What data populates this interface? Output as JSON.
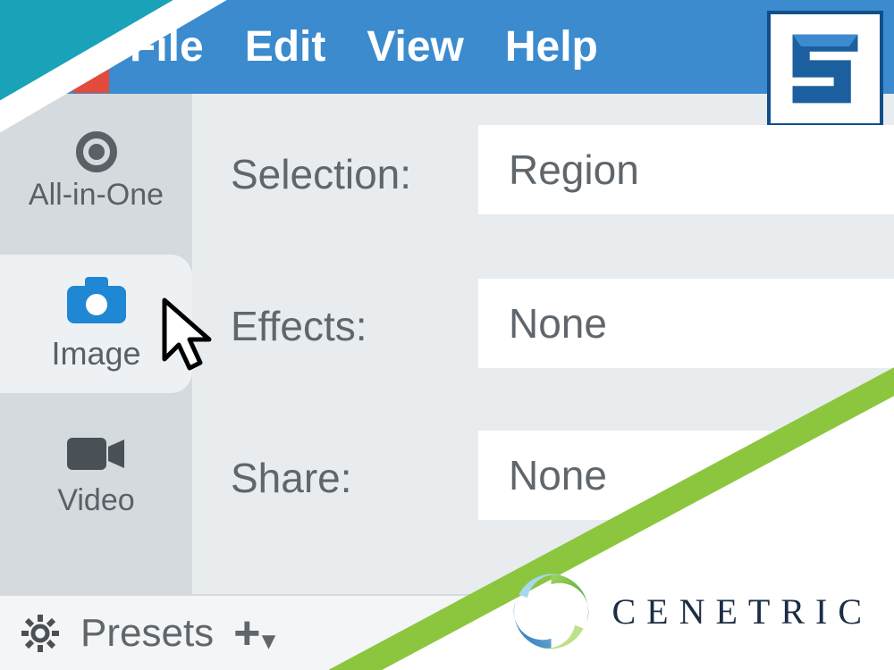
{
  "menu": {
    "file": "File",
    "edit": "Edit",
    "view": "View",
    "help": "Help"
  },
  "tabs": {
    "all": {
      "label": "All-in-One"
    },
    "image": {
      "label": "Image"
    },
    "video": {
      "label": "Video"
    }
  },
  "props": {
    "selection": {
      "label": "Selection:",
      "value": "Region"
    },
    "effects": {
      "label": "Effects:",
      "value": "None"
    },
    "share": {
      "label": "Share:",
      "value": "None"
    }
  },
  "bottom": {
    "presets": "Presets",
    "add": "+"
  },
  "branding": {
    "cenetric": "CENETRIC"
  }
}
